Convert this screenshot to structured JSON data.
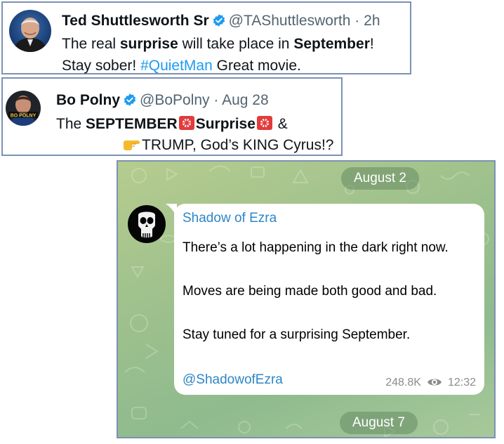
{
  "tweet1": {
    "name": "Ted Shuttlesworth Sr",
    "handle": "@TAShuttlesworth",
    "sep": "·",
    "time": "2h",
    "line1_a": "The real ",
    "line1_b": "surprise",
    "line1_c": " will take place in ",
    "line1_d": "September",
    "line1_e": "!",
    "line2_a": "Stay sober! ",
    "line2_hashtag": "#QuietMan",
    "line2_c": "  Great movie."
  },
  "tweet2": {
    "name": "Bo Polny",
    "handle": "@BoPolny",
    "sep": "·",
    "time": "Aug 28",
    "line1_a": "The ",
    "line1_b": "SEPTEMBER",
    "line1_c": "Surprise",
    "line1_d": " &",
    "line2": "TRUMP, God’s KING Cyrus!?",
    "avatar_text": "BO POLNY"
  },
  "telegram": {
    "date_top": "August 2",
    "date_bottom": "August 7",
    "sender": "Shadow of Ezra",
    "line1": "There’s a lot happening in the dark right now.",
    "line2": "Moves are being made both good and bad.",
    "line3": "Stay tuned for a surprising September.",
    "link": "@ShadowofEzra",
    "views": "248.8K",
    "time": "12:32"
  },
  "icons": {
    "verified": "verified-badge-icon",
    "siren": "police-light-icon",
    "pointer": "backhand-index-pointing-right-icon",
    "eye": "eye-icon",
    "channel_avatar": "punisher-skull-icon"
  },
  "colors": {
    "tweet_border": "#7d91b3",
    "verified": "#1d9bf0",
    "hashtag": "#1d9bf0",
    "telegram_link": "#2d86c6",
    "telegram_bg": "#9dc08d"
  }
}
